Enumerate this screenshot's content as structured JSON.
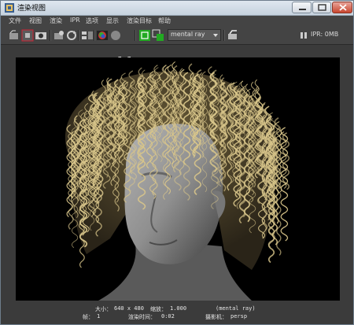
{
  "window": {
    "title": "渲染视图"
  },
  "menu": [
    "文件",
    "视图",
    "渲染",
    "IPR",
    "选项",
    "显示",
    "渲染目标",
    "帮助"
  ],
  "toolbar": {
    "ratio_label": "1:1",
    "renderer": "mental ray",
    "ipr_status": "IPR: 0MB"
  },
  "status": {
    "size_label": "大小：",
    "size_value": "640 x 480",
    "zoom_label": "缩放：",
    "zoom_value": "1.000",
    "renderer": "(mental ray)",
    "frame_label": "帧：",
    "frame_value": "1",
    "time_label": "渲染时间：",
    "time_value": "0:02",
    "camera_label": "摄影机：",
    "camera_value": "persp"
  },
  "icons": [
    "app-icon",
    "minimize-icon",
    "maximize-icon",
    "close-icon",
    "redo-render-icon",
    "region-render-icon",
    "snapshot-icon",
    "ipr-render-icon",
    "refresh-icon",
    "keep-image-icon",
    "color-channels-icon",
    "alpha-channel-icon",
    "real-size-icon",
    "region-toggle-icon",
    "display-icon",
    "settings-icon",
    "pause-icon"
  ],
  "colors": {
    "hair": "#d8c58a",
    "window_bg": "#3b3b3b",
    "viewport_bg": "#000000"
  }
}
